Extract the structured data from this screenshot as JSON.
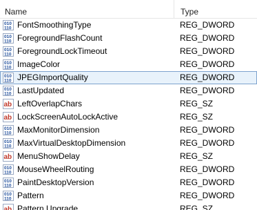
{
  "columns": {
    "name": "Name",
    "type": "Type"
  },
  "rows": [
    {
      "name": "FontSmoothingType",
      "type": "REG_DWORD",
      "icon": "binary-value-icon"
    },
    {
      "name": "ForegroundFlashCount",
      "type": "REG_DWORD",
      "icon": "binary-value-icon"
    },
    {
      "name": "ForegroundLockTimeout",
      "type": "REG_DWORD",
      "icon": "binary-value-icon"
    },
    {
      "name": "ImageColor",
      "type": "REG_DWORD",
      "icon": "binary-value-icon"
    },
    {
      "name": "JPEGImportQuality",
      "type": "REG_DWORD",
      "icon": "binary-value-icon",
      "selected": true
    },
    {
      "name": "LastUpdated",
      "type": "REG_DWORD",
      "icon": "binary-value-icon"
    },
    {
      "name": "LeftOverlapChars",
      "type": "REG_SZ",
      "icon": "string-value-icon"
    },
    {
      "name": "LockScreenAutoLockActive",
      "type": "REG_SZ",
      "icon": "string-value-icon"
    },
    {
      "name": "MaxMonitorDimension",
      "type": "REG_DWORD",
      "icon": "binary-value-icon"
    },
    {
      "name": "MaxVirtualDesktopDimension",
      "type": "REG_DWORD",
      "icon": "binary-value-icon"
    },
    {
      "name": "MenuShowDelay",
      "type": "REG_SZ",
      "icon": "string-value-icon"
    },
    {
      "name": "MouseWheelRouting",
      "type": "REG_DWORD",
      "icon": "binary-value-icon"
    },
    {
      "name": "PaintDesktopVersion",
      "type": "REG_DWORD",
      "icon": "binary-value-icon"
    },
    {
      "name": "Pattern",
      "type": "REG_DWORD",
      "icon": "binary-value-icon"
    },
    {
      "name": "Pattern Upgrade",
      "type": "REG_SZ",
      "icon": "string-value-icon"
    }
  ],
  "colors": {
    "selection_border": "#7da2ce",
    "selection_fill": "#e8f2fb",
    "binary_icon": "#1f4e9c",
    "string_icon": "#c0392b"
  }
}
